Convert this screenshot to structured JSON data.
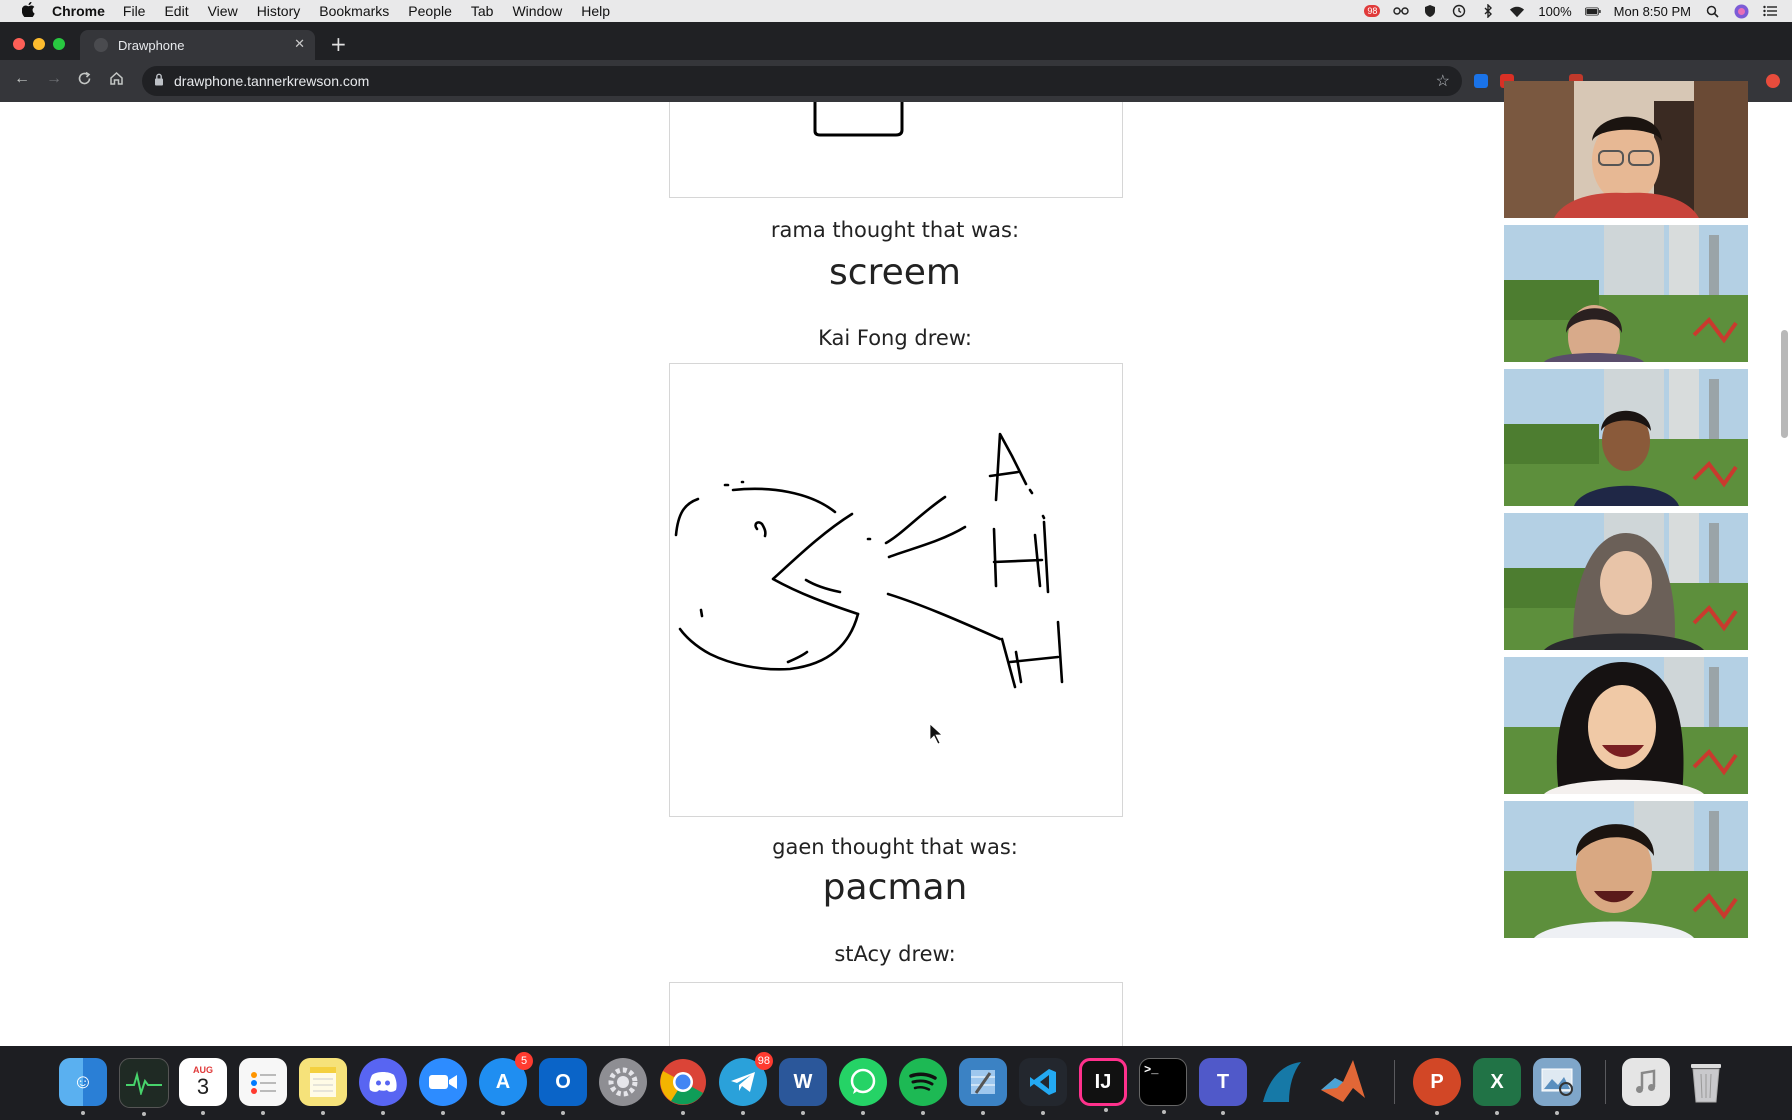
{
  "menubar": {
    "app": "Chrome",
    "menus": [
      "File",
      "Edit",
      "View",
      "History",
      "Bookmarks",
      "People",
      "Tab",
      "Window",
      "Help"
    ],
    "status": {
      "notif_badge": "98",
      "battery": "100%",
      "clock": "Mon 8:50 PM"
    }
  },
  "browser": {
    "tab_title": "Drawphone",
    "url": "drawphone.tannerkrewson.com"
  },
  "page": {
    "entry1_caption": "rama thought that was:",
    "entry1_guess": "screem",
    "entry2_caption": "Kai Fong drew:",
    "entry3_caption": "gaen thought that was:",
    "entry3_guess": "pacman",
    "entry4_caption": "stAcy drew:"
  },
  "video_call": {
    "participant_count": 6
  },
  "dock": {
    "calendar": {
      "month": "AUG",
      "day": "3"
    },
    "badges": {
      "app_store": "5",
      "telegram": "98"
    },
    "labels": {
      "outlook": "O",
      "word": "W",
      "intellij": "IJ",
      "teams": "T",
      "powerpoint": "P",
      "excel": "X"
    }
  },
  "colors": {
    "menubar_bg": "#e9e9ea",
    "chrome_tabstrip": "#202124",
    "chrome_toolbar": "#35363a",
    "page_bg": "#ffffff",
    "drawing_ink": "#000000",
    "badge_red": "#ff3b30"
  }
}
